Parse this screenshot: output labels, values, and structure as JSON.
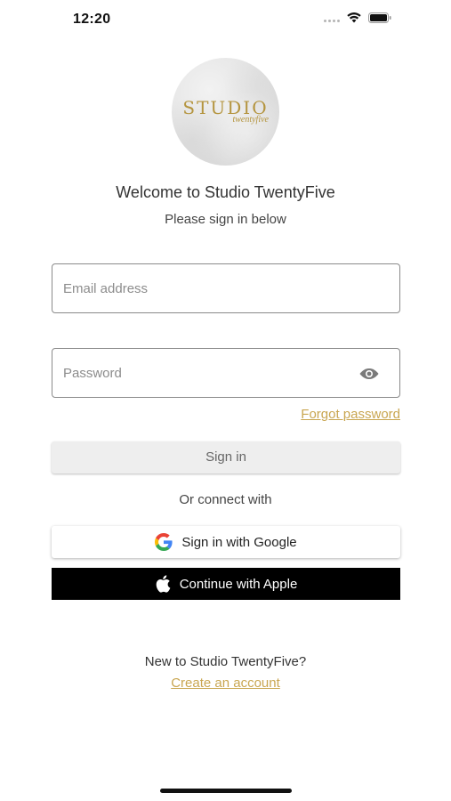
{
  "status_bar": {
    "time": "12:20"
  },
  "logo": {
    "main_text": "STUDIO",
    "sub_text": "twentyfive",
    "accent_color": "#b4943e"
  },
  "header": {
    "title": "Welcome to Studio TwentyFive",
    "subtitle": "Please sign in below"
  },
  "form": {
    "email_placeholder": "Email address",
    "email_value": "",
    "password_placeholder": "Password",
    "password_value": "",
    "forgot_password_label": "Forgot password",
    "sign_in_label": "Sign in"
  },
  "social": {
    "divider_text": "Or connect with",
    "google_label": "Sign in with Google",
    "apple_label": "Continue with Apple"
  },
  "footer": {
    "prompt": "New to Studio TwentyFive?",
    "create_account_label": "Create an account"
  },
  "colors": {
    "link": "#c9a651",
    "apple_button_bg": "#000000",
    "sign_in_button_bg": "#eeeeee"
  },
  "icons": {
    "wifi": "wifi-icon",
    "battery": "battery-icon",
    "signal": "signal-icon",
    "eye": "eye-icon",
    "google": "google-icon",
    "apple": "apple-icon"
  }
}
